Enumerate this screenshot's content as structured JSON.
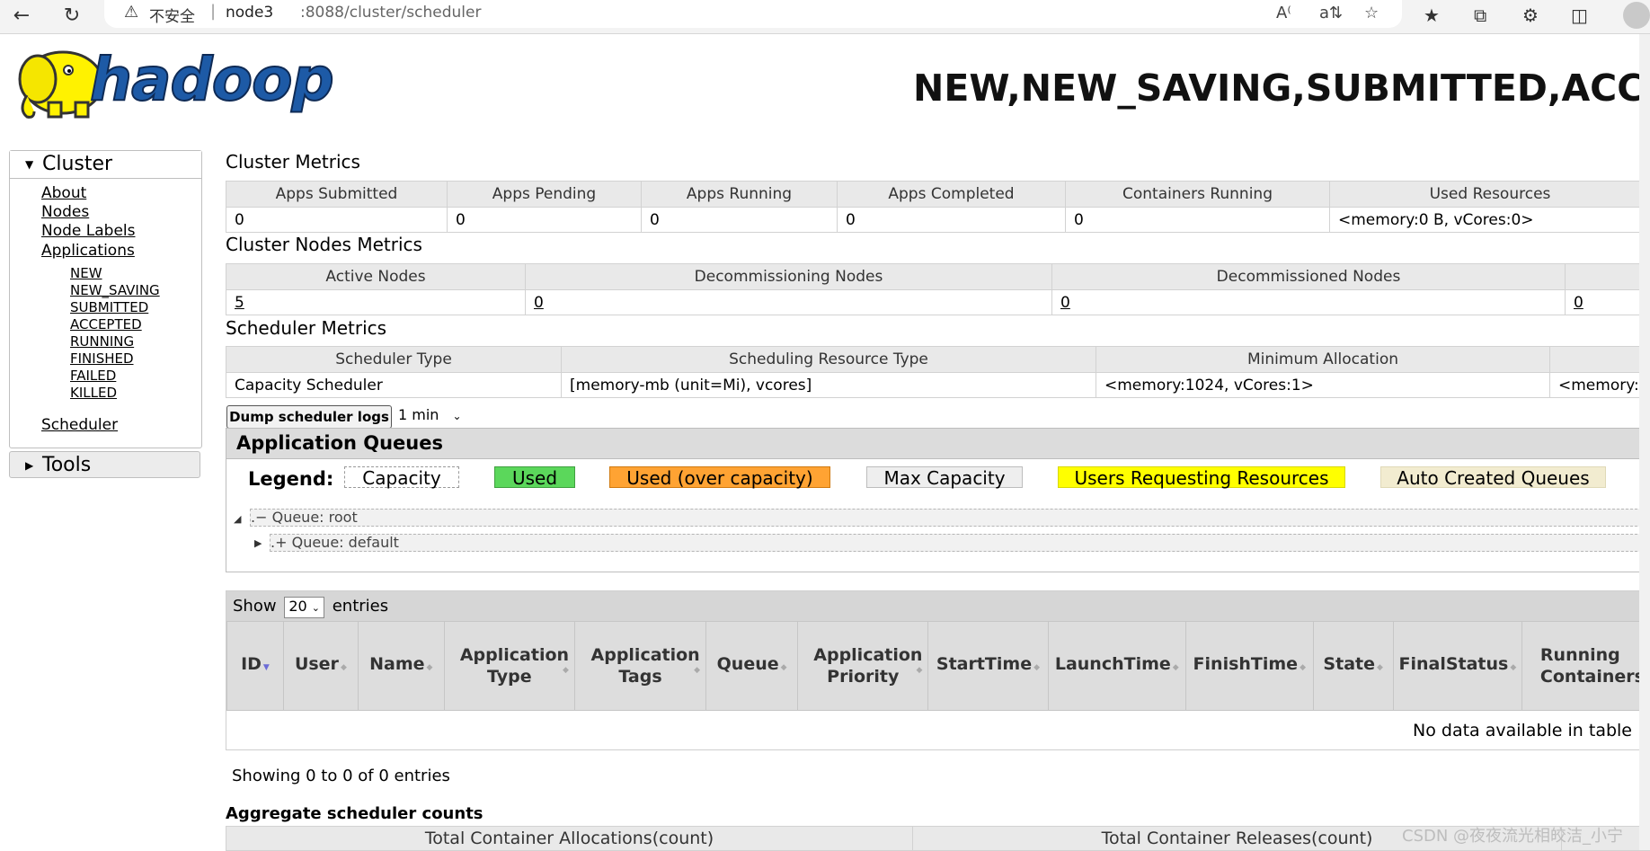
{
  "browser": {
    "security_warning": "不安全",
    "url_host": "node3",
    "url_path": ":8088/cluster/scheduler"
  },
  "header": {
    "logo_text": "hadoop",
    "page_title": "NEW,NEW_SAVING,SUBMITTED,ACC"
  },
  "sidebar": {
    "cluster_label": "Cluster",
    "links": [
      "About",
      "Nodes",
      "Node Labels",
      "Applications"
    ],
    "app_states": [
      "NEW",
      "NEW_SAVING",
      "SUBMITTED",
      "ACCEPTED",
      "RUNNING",
      "FINISHED",
      "FAILED",
      "KILLED"
    ],
    "scheduler_link": "Scheduler",
    "tools_label": "Tools"
  },
  "cluster_metrics": {
    "title": "Cluster Metrics",
    "headers": [
      "Apps Submitted",
      "Apps Pending",
      "Apps Running",
      "Apps Completed",
      "Containers Running",
      "Used Resources"
    ],
    "values": [
      "0",
      "0",
      "0",
      "0",
      "0",
      "<memory:0 B, vCores:0>"
    ]
  },
  "cluster_nodes_metrics": {
    "title": "Cluster Nodes Metrics",
    "headers": [
      "Active Nodes",
      "Decommissioning Nodes",
      "Decommissioned Nodes",
      ""
    ],
    "values": [
      "5",
      "0",
      "0",
      "0"
    ]
  },
  "scheduler_metrics": {
    "title": "Scheduler Metrics",
    "headers": [
      "Scheduler Type",
      "Scheduling Resource Type",
      "Minimum Allocation",
      ""
    ],
    "values": [
      "Capacity Scheduler",
      "[memory-mb (unit=Mi), vcores]",
      "<memory:1024, vCores:1>",
      "<memory:"
    ]
  },
  "dump": {
    "button_label": "Dump scheduler logs",
    "interval": "1 min"
  },
  "app_queues": {
    "title": "Application Queues",
    "legend_label": "Legend:",
    "legend": [
      {
        "label": "Capacity",
        "color": "#ffffff"
      },
      {
        "label": "Used",
        "color": "#5bd75b"
      },
      {
        "label": "Used (over capacity)",
        "color": "#ffa333"
      },
      {
        "label": "Max Capacity",
        "color": "#eeeeee"
      },
      {
        "label": "Users Requesting Resources",
        "color": "#ffff00"
      },
      {
        "label": "Auto Created Queues",
        "color": "#f2ecd0"
      }
    ],
    "queues": [
      {
        "prefix": ".−",
        "label": "Queue: root"
      },
      {
        "prefix": ".+",
        "label": "Queue: default"
      }
    ]
  },
  "applications": {
    "show_label": "Show",
    "entries_count": "20",
    "entries_label": "entries",
    "columns": [
      "ID",
      "User",
      "Name",
      "Application Type",
      "Application Tags",
      "Queue",
      "Application Priority",
      "StartTime",
      "LaunchTime",
      "FinishTime",
      "State",
      "FinalStatus",
      "Running Containers"
    ],
    "no_data": "No data available in table",
    "showing": "Showing 0 to 0 of 0 entries"
  },
  "aggregate": {
    "title": "Aggregate scheduler counts",
    "headers": [
      "Total Container Allocations(count)",
      "Total Container Releases(count)"
    ]
  },
  "watermark": "CSDN @夜夜流光相皎洁_小宁"
}
